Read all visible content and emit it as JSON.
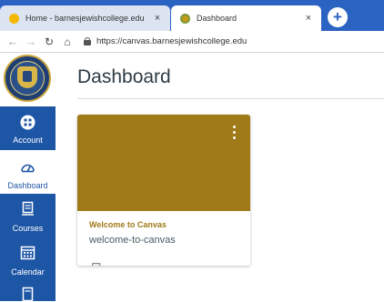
{
  "browser": {
    "tabs": [
      {
        "title": "Home - barnesjewishcollege.edu",
        "close": "×",
        "active": false
      },
      {
        "title": "Dashboard",
        "close": "×",
        "active": true
      }
    ],
    "new_tab": "+",
    "url": "https://canvas.barnesjewishcollege.edu"
  },
  "global_nav": {
    "items": [
      {
        "label": "Account",
        "icon": "account-icon"
      },
      {
        "label": "Dashboard",
        "icon": "dashboard-icon"
      },
      {
        "label": "Courses",
        "icon": "courses-icon"
      },
      {
        "label": "Calendar",
        "icon": "calendar-icon"
      },
      {
        "label": "",
        "icon": "inbox-icon"
      }
    ]
  },
  "main": {
    "title": "Dashboard",
    "cards": [
      {
        "name": "Welcome to Canvas",
        "code": "welcome-to-canvas",
        "color": "#a07918",
        "icon": "discussion-icon"
      }
    ]
  },
  "colors": {
    "brand_blue": "#1e56a6",
    "chrome_blue": "#2b63c2",
    "card_color": "#a07918"
  }
}
